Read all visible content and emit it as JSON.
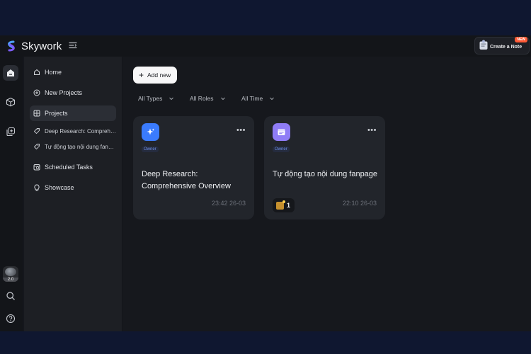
{
  "header": {
    "brand": "Skywork",
    "create_note_label": "Create a Note",
    "create_note_badge": "NEW"
  },
  "rail": {
    "avatar_version": "2.0"
  },
  "sidebar": {
    "items": [
      {
        "label": "Home",
        "icon": "home-icon"
      },
      {
        "label": "New Projects",
        "icon": "plus-circle-icon"
      },
      {
        "label": "Projects",
        "icon": "grid-icon"
      },
      {
        "label": "Deep Research: Comprehensive Overview",
        "icon": "sparkle-tag-icon"
      },
      {
        "label": "Tự động tạo nội dung fanpage",
        "icon": "sparkle-tag-icon"
      },
      {
        "label": "Scheduled Tasks",
        "icon": "calendar-clock-icon"
      },
      {
        "label": "Showcase",
        "icon": "lightbulb-icon"
      }
    ]
  },
  "main": {
    "add_new_label": "Add new",
    "filters": [
      "All Types",
      "All Roles",
      "All Time"
    ],
    "cards": [
      {
        "icon": "sparkle-icon",
        "icon_color": "#3a7bfd",
        "owner_label": "Owner",
        "title": "Deep Research: Comprehensive Overview",
        "time": "23:42 26-03"
      },
      {
        "icon": "browser-icon",
        "icon_color": "#8f7cf6",
        "owner_label": "Owner",
        "title": "Tự động tạo nội dung fanpage",
        "task_count": "1",
        "time": "22:10 26-03"
      }
    ]
  },
  "colors": {
    "accent_blue": "#3a7bfd",
    "accent_purple": "#8f7cf6",
    "badge_orange": "#ff5a36",
    "owner_blue": "#6f8fe8"
  }
}
